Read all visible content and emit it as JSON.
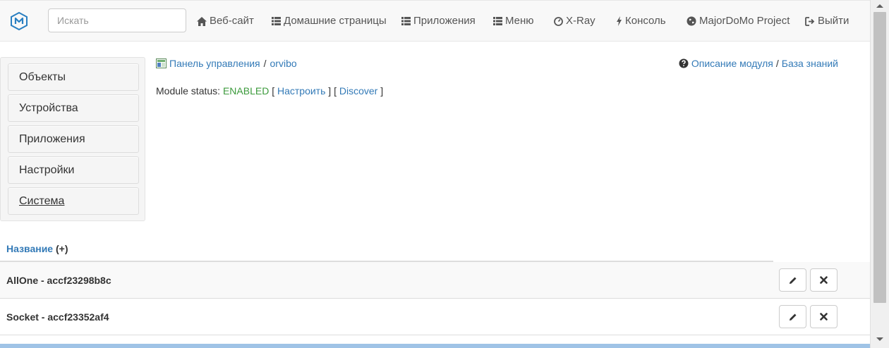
{
  "search": {
    "placeholder": "Искать"
  },
  "nav": {
    "items": [
      {
        "label": "Веб-сайт",
        "icon": "home-icon"
      },
      {
        "label": "Домашние страницы",
        "icon": "list-icon"
      },
      {
        "label": "Приложения",
        "icon": "list-icon"
      },
      {
        "label": "Меню",
        "icon": "list-icon"
      },
      {
        "label": "X-Ray",
        "icon": "dashboard-icon"
      },
      {
        "label": "Консоль",
        "icon": "bolt-icon"
      },
      {
        "label": "MajorDoMo Project",
        "icon": "globe-icon"
      },
      {
        "label": "Выйти",
        "icon": "logout-icon"
      }
    ]
  },
  "sidebar": {
    "items": [
      {
        "label": "Объекты"
      },
      {
        "label": "Устройства"
      },
      {
        "label": "Приложения"
      },
      {
        "label": "Настройки"
      },
      {
        "label": "Система"
      }
    ]
  },
  "breadcrumb": {
    "control_panel": "Панель управления",
    "separator": "/",
    "current": "orvibo"
  },
  "help": {
    "module_description": "Описание модуля",
    "separator": "/",
    "knowledge_base": "База знаний"
  },
  "module": {
    "status_label": "Module status:",
    "status_value": "ENABLED",
    "bracket_open": "[",
    "configure": "Настроить",
    "bracket_mid": "] [",
    "discover": "Discover",
    "bracket_close": "]"
  },
  "table": {
    "header_label": "Название",
    "header_add": "(+)",
    "rows": [
      {
        "title": "AllOne - accf23298b8c"
      },
      {
        "title": "Socket - accf23352af4"
      }
    ]
  },
  "colors": {
    "link": "#337ab7",
    "enabled": "#3c9a3c",
    "navbar_bg": "#f8f8f8",
    "logo": "#2a7fc1"
  }
}
